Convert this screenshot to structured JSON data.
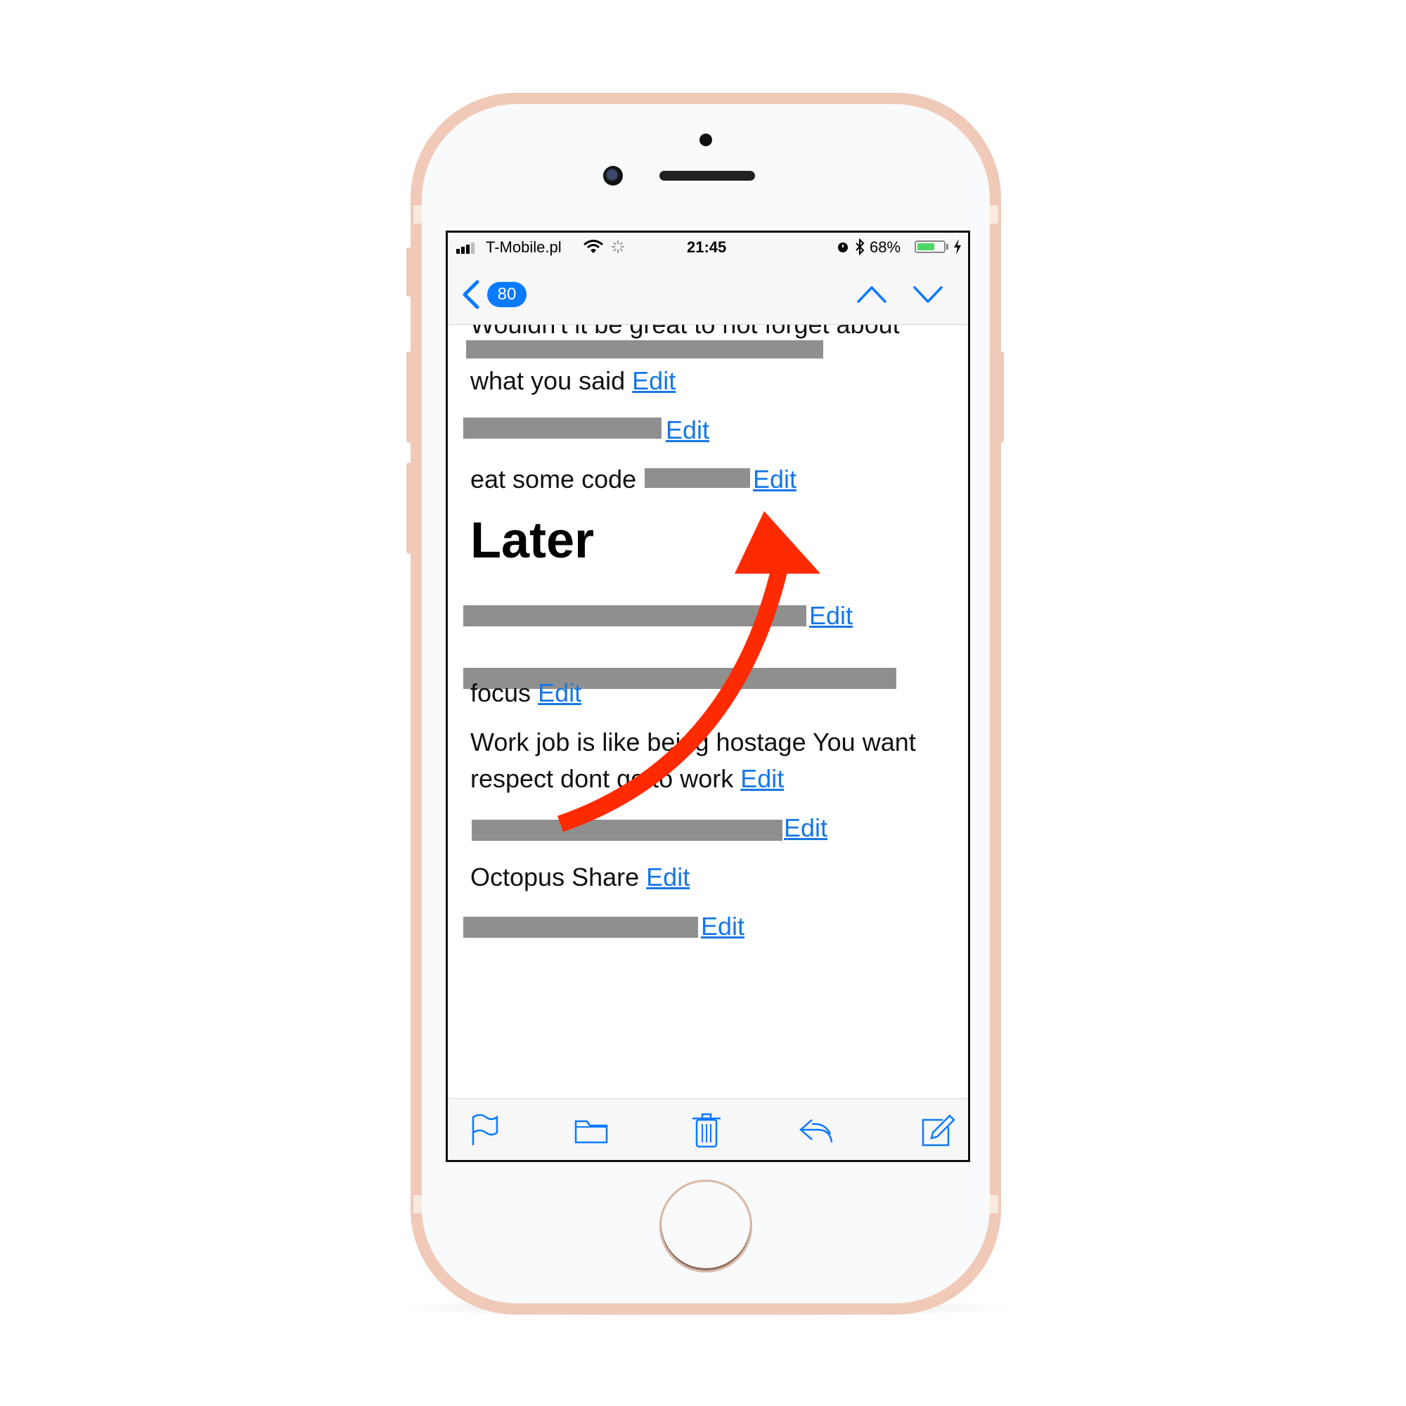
{
  "status_bar": {
    "carrier": "T-Mobile.pl",
    "time": "21:45",
    "battery_percent": "68%",
    "battery_level": 0.68
  },
  "nav_bar": {
    "unread_count": "80"
  },
  "content": {
    "top_partial_line": "Wouldn't it be great to not forget about",
    "item1_line2": "what you said",
    "edit_label": "Edit",
    "item3_text": "eat some code",
    "section_heading": "Later",
    "item5_line2": "focus",
    "item6_line1": "Work job is like being hostage You want",
    "item6_line2": "respect dont go to work",
    "item8_text": "Octopus Share"
  },
  "colors": {
    "accent": "#0a7aff",
    "link": "#1677e6",
    "annotation_arrow": "#ff2a00",
    "redaction": "#8f8f8f",
    "phone_frame": "#f0c9b8"
  }
}
